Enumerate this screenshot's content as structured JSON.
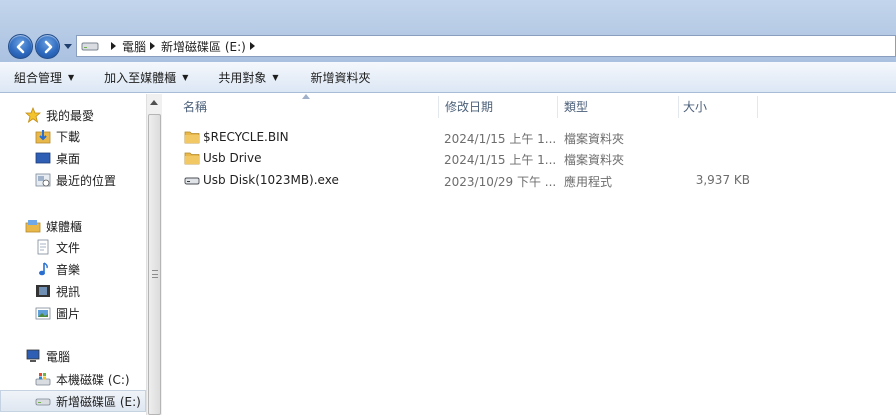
{
  "address": {
    "crumbs": [
      "電腦",
      "新增磁碟區 (E:)"
    ]
  },
  "toolbar": {
    "organize": "組合管理",
    "add_to_library": "加入至媒體櫃",
    "share_with": "共用對象",
    "new_folder": "新增資料夾"
  },
  "nav": {
    "favorites": "我的最愛",
    "downloads": "下載",
    "desktop": "桌面",
    "recent": "最近的位置",
    "libraries": "媒體櫃",
    "documents": "文件",
    "music": "音樂",
    "videos": "視訊",
    "pictures": "圖片",
    "computer": "電腦",
    "local_disk": "本機磁碟 (C:)",
    "new_volume": "新增磁碟區 (E:)"
  },
  "columns": {
    "name": "名稱",
    "date": "修改日期",
    "type": "類型",
    "size": "大小"
  },
  "files": [
    {
      "name": "$RECYCLE.BIN",
      "date": "2024/1/15 上午 1...",
      "type": "檔案資料夾",
      "size": "",
      "icon": "folder-icon"
    },
    {
      "name": "Usb Drive",
      "date": "2024/1/15 上午 1...",
      "type": "檔案資料夾",
      "size": "",
      "icon": "folder-icon"
    },
    {
      "name": "Usb Disk(1023MB).exe",
      "date": "2023/10/29 下午 ...",
      "type": "應用程式",
      "size": "3,937 KB",
      "icon": "drive-exe-icon"
    }
  ],
  "colors": {
    "title_gradient_top": "#c3d5ec",
    "toolbar_bg": "#e8eff8",
    "header_text": "#4c607a",
    "folder": "#e8b84a"
  }
}
